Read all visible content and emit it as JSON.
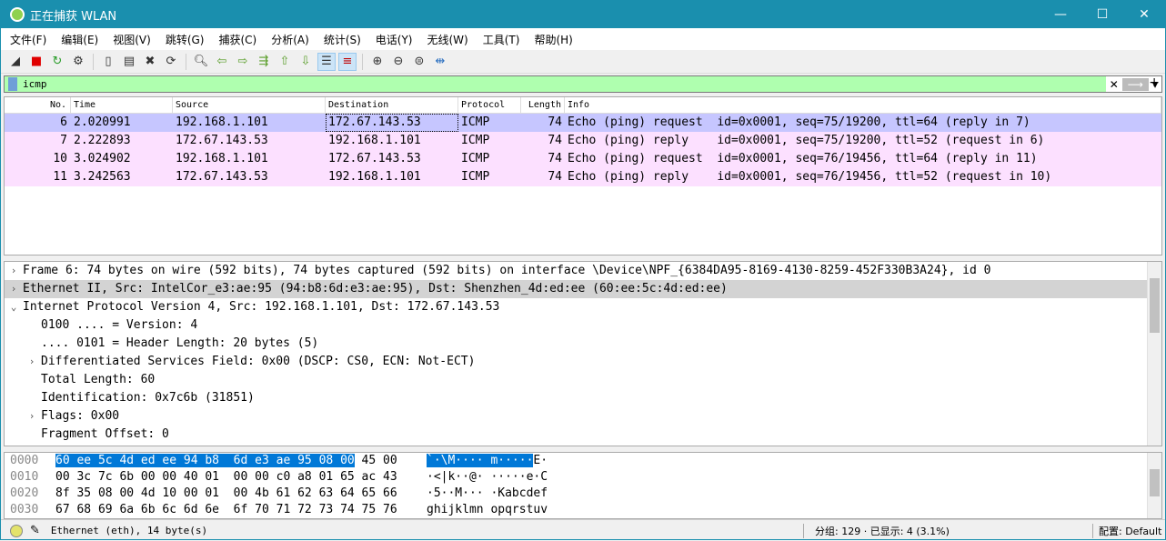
{
  "window": {
    "title": "正在捕获 WLAN",
    "minimize": "—",
    "maximize": "☐",
    "close": "✕"
  },
  "menu": [
    "文件(F)",
    "编辑(E)",
    "视图(V)",
    "跳转(G)",
    "捕获(C)",
    "分析(A)",
    "统计(S)",
    "电话(Y)",
    "无线(W)",
    "工具(T)",
    "帮助(H)"
  ],
  "toolbar": [
    {
      "icon": "shark-fin-start-icon",
      "glyph": "◢"
    },
    {
      "icon": "stop-capture-icon",
      "glyph": "■",
      "color": "#e00000"
    },
    {
      "icon": "restart-capture-icon",
      "glyph": "↻",
      "color": "#2a9d2a"
    },
    {
      "icon": "capture-options-icon",
      "glyph": "⚙"
    },
    "sep",
    {
      "icon": "open-file-icon",
      "glyph": "▯"
    },
    {
      "icon": "save-file-icon",
      "glyph": "▤"
    },
    {
      "icon": "close-file-icon",
      "glyph": "✖"
    },
    {
      "icon": "reload-file-icon",
      "glyph": "⟳"
    },
    "sep",
    {
      "icon": "find-packet-icon",
      "glyph": "🔍︎"
    },
    {
      "icon": "go-back-icon",
      "glyph": "⇦",
      "color": "#5a9e2a"
    },
    {
      "icon": "go-forward-icon",
      "glyph": "⇨",
      "color": "#5a9e2a"
    },
    {
      "icon": "go-to-packet-icon",
      "glyph": "⇶",
      "color": "#5a9e2a"
    },
    {
      "icon": "first-packet-icon",
      "glyph": "⇧",
      "color": "#5a9e2a"
    },
    {
      "icon": "last-packet-icon",
      "glyph": "⇩",
      "color": "#5a9e2a"
    },
    {
      "icon": "autoscroll-icon",
      "glyph": "☰",
      "active": true
    },
    {
      "icon": "colorize-icon",
      "glyph": "≡",
      "active": true,
      "color": "#c00000"
    },
    "sep",
    {
      "icon": "zoom-in-icon",
      "glyph": "⊕"
    },
    {
      "icon": "zoom-out-icon",
      "glyph": "⊖"
    },
    {
      "icon": "zoom-reset-icon",
      "glyph": "⊜"
    },
    {
      "icon": "resize-columns-icon",
      "glyph": "⇹",
      "color": "#2a6fc0"
    }
  ],
  "filter": {
    "value": "icmp",
    "clear": "✕",
    "apply": "⟶",
    "dropdown": "▾",
    "add": "+"
  },
  "packet_list": {
    "columns": [
      "No.",
      "Time",
      "Source",
      "Destination",
      "Protocol",
      "Length",
      "Info"
    ],
    "rows": [
      {
        "no": "6",
        "time": "2.020991",
        "src": "192.168.1.101",
        "dst": "172.67.143.53",
        "proto": "ICMP",
        "len": "74",
        "info": "Echo (ping) request  id=0x0001, seq=75/19200, ttl=64 (reply in 7)",
        "selected": true
      },
      {
        "no": "7",
        "time": "2.222893",
        "src": "172.67.143.53",
        "dst": "192.168.1.101",
        "proto": "ICMP",
        "len": "74",
        "info": "Echo (ping) reply    id=0x0001, seq=75/19200, ttl=52 (request in 6)"
      },
      {
        "no": "10",
        "time": "3.024902",
        "src": "192.168.1.101",
        "dst": "172.67.143.53",
        "proto": "ICMP",
        "len": "74",
        "info": "Echo (ping) request  id=0x0001, seq=76/19456, ttl=64 (reply in 11)"
      },
      {
        "no": "11",
        "time": "3.242563",
        "src": "172.67.143.53",
        "dst": "192.168.1.101",
        "proto": "ICMP",
        "len": "74",
        "info": "Echo (ping) reply    id=0x0001, seq=76/19456, ttl=52 (request in 10)"
      }
    ],
    "row_color": "#fce0ff",
    "selected_color": "#c6c6ff"
  },
  "details": [
    {
      "level": 0,
      "arrow": "›",
      "text": "Frame 6: 74 bytes on wire (592 bits), 74 bytes captured (592 bits) on interface \\Device\\NPF_{6384DA95-8169-4130-8259-452F330B3A24}, id 0"
    },
    {
      "level": 0,
      "arrow": "›",
      "text": "Ethernet II, Src: IntelCor_e3:ae:95 (94:b8:6d:e3:ae:95), Dst: Shenzhen_4d:ed:ee (60:ee:5c:4d:ed:ee)",
      "highlight": true
    },
    {
      "level": 0,
      "arrow": "⌄",
      "text": "Internet Protocol Version 4, Src: 192.168.1.101, Dst: 172.67.143.53"
    },
    {
      "level": 1,
      "text": "0100 .... = Version: 4"
    },
    {
      "level": 1,
      "text": ".... 0101 = Header Length: 20 bytes (5)"
    },
    {
      "level": 1,
      "arrow": "›",
      "text": "Differentiated Services Field: 0x00 (DSCP: CS0, ECN: Not-ECT)"
    },
    {
      "level": 1,
      "text": "Total Length: 60"
    },
    {
      "level": 1,
      "text": "Identification: 0x7c6b (31851)"
    },
    {
      "level": 1,
      "arrow": "›",
      "text": "Flags: 0x00"
    },
    {
      "level": 1,
      "text": "Fragment Offset: 0"
    }
  ],
  "hex": [
    {
      "offset": "0000",
      "bytes_sel": "60 ee 5c 4d ed ee 94 b8  6d e3 ae 95 08 00",
      "bytes": " 45 00",
      "ascii_sel": "`·\\M···· m·····",
      "ascii": "E·"
    },
    {
      "offset": "0010",
      "bytes": "00 3c 7c 6b 00 00 40 01  00 00 c0 a8 01 65 ac 43",
      "ascii": "·<|k··@· ·····e·C"
    },
    {
      "offset": "0020",
      "bytes": "8f 35 08 00 4d 10 00 01  00 4b 61 62 63 64 65 66",
      "ascii": "·5··M··· ·Kabcdef"
    },
    {
      "offset": "0030",
      "bytes": "67 68 69 6a 6b 6c 6d 6e  6f 70 71 72 73 74 75 76",
      "ascii": "ghijklmn opqrstuv"
    }
  ],
  "status": {
    "field": "Ethernet (eth), 14 byte(s)",
    "packets": "分组: 129 · 已显示: 4 (3.1%)",
    "profile": "配置: Default"
  }
}
